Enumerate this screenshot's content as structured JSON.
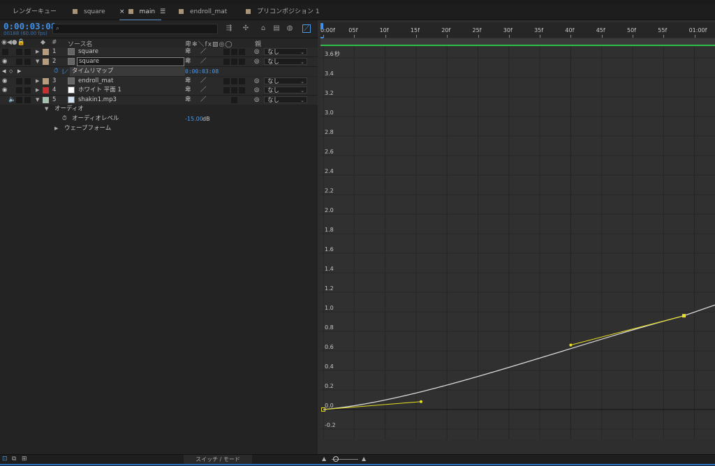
{
  "tabs": [
    {
      "label": "レンダーキュー",
      "swatch": false,
      "active": false
    },
    {
      "label": "square",
      "swatch": true,
      "active": false
    },
    {
      "label": "main",
      "swatch": true,
      "active": true,
      "close": "×",
      "menu": "☰"
    },
    {
      "label": "endroll_mat",
      "swatch": true,
      "active": false
    },
    {
      "label": "プリコンポジション 1",
      "swatch": true,
      "active": false
    }
  ],
  "timecode": "0:00:03:08",
  "fps_label": "00188 (60.00 fps)",
  "search": {
    "icon": "search-icon",
    "placeholder": ""
  },
  "column_headers": {
    "visibility": "◉",
    "label_col": "#",
    "source_name": "ソース名",
    "switches": "卑✻＼fx▨◎◯",
    "parent": "親"
  },
  "layers": [
    {
      "num": "1",
      "name": "square",
      "color": "#b79d7c",
      "type": "comp",
      "parent": "なし",
      "eye": true,
      "audio": false,
      "expanded": false
    },
    {
      "num": "2",
      "name": "square",
      "color": "#b79d7c",
      "type": "comp",
      "parent": "なし",
      "eye": true,
      "audio": false,
      "expanded": true,
      "editing": true
    },
    {
      "num": "3",
      "name": "endroll_mat",
      "color": "#b79d7c",
      "type": "comp",
      "parent": "なし",
      "eye": true,
      "audio": false,
      "expanded": false
    },
    {
      "num": "4",
      "name": "ホワイト 平面 1",
      "color": "#c83030",
      "type": "solid",
      "parent": "なし",
      "eye": true,
      "audio": false,
      "expanded": false
    },
    {
      "num": "5",
      "name": "shakin1.mp3",
      "color": "#a8c0b0",
      "type": "audio",
      "parent": "なし",
      "eye": false,
      "audio": true,
      "expanded": true
    }
  ],
  "time_remap": {
    "label": "タイムリマップ",
    "value": "0:00:03:08"
  },
  "audio_group": {
    "label": "オーディオ"
  },
  "audio_level": {
    "label": "オーディオレベル",
    "value": "-15.00",
    "unit": "dB"
  },
  "waveform": {
    "label": "ウェーブフォーム"
  },
  "ruler_labels": [
    "0:00f",
    "05f",
    "10f",
    "15f",
    "20f",
    "25f",
    "30f",
    "35f",
    "40f",
    "45f",
    "50f",
    "55f",
    "01:00f"
  ],
  "graph": {
    "unit_label": "秒",
    "y_labels": [
      "3.6",
      "3.4",
      "3.2",
      "3.0",
      "2.8",
      "2.6",
      "2.4",
      "2.2",
      "2.0",
      "1.8",
      "1.6",
      "1.4",
      "1.2",
      "1.0",
      "0.8",
      "0.6",
      "0.4",
      "0.2",
      "0.0",
      "-0.2"
    ],
    "curve_color": "#d9d9d9",
    "handle_color": "#e8e020"
  },
  "footer": {
    "switch_mode": "スイッチ / モード"
  },
  "colors": {
    "timecode": "#3f8fe8",
    "accent_blue": "#2d6fc0",
    "work_area": "#2fc04b"
  }
}
